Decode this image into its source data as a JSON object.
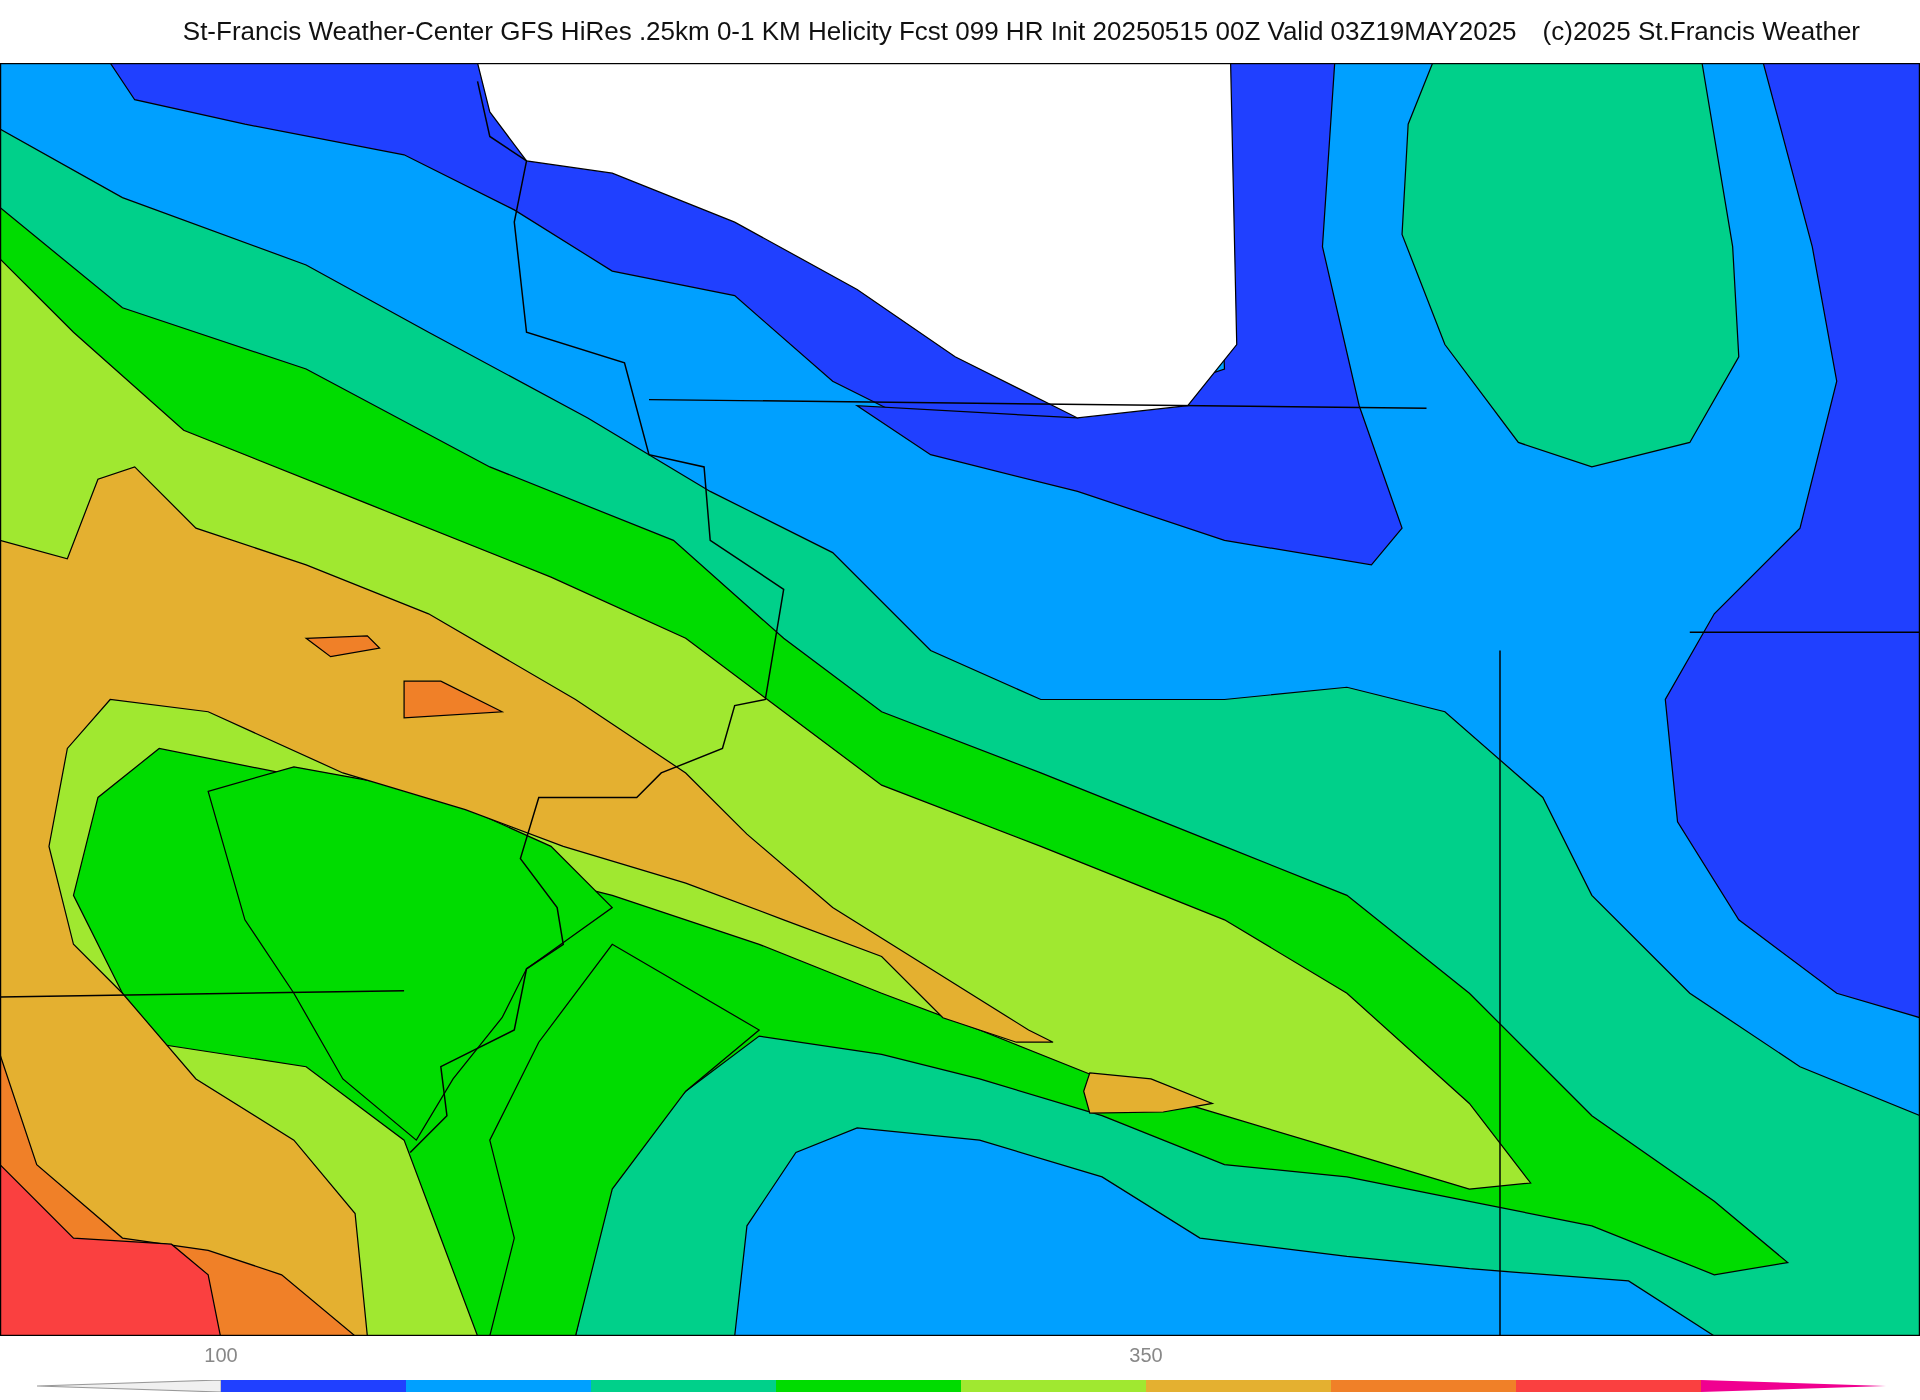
{
  "header": {
    "title": "St-Francis Weather-Center GFS HiRes .25km 0-1 KM Helicity Fcst 099 HR Init 20250515 00Z  Valid 03Z19MAY2025",
    "credit": "(c)2025 St.Francis Weather"
  },
  "colorbar": {
    "segments": [
      {
        "kind": "start",
        "color": "#f0f0f0"
      },
      {
        "kind": "bar",
        "color": "#2040ff",
        "label": "100"
      },
      {
        "kind": "bar",
        "color": "#00a0ff"
      },
      {
        "kind": "bar",
        "color": "#00d08a"
      },
      {
        "kind": "bar",
        "color": "#00dc00"
      },
      {
        "kind": "bar",
        "color": "#a0e830"
      },
      {
        "kind": "bar",
        "color": "#e4b030",
        "label": "350"
      },
      {
        "kind": "bar",
        "color": "#f08028"
      },
      {
        "kind": "bar",
        "color": "#fa4040"
      },
      {
        "kind": "end",
        "color": "#f00090"
      }
    ]
  }
}
